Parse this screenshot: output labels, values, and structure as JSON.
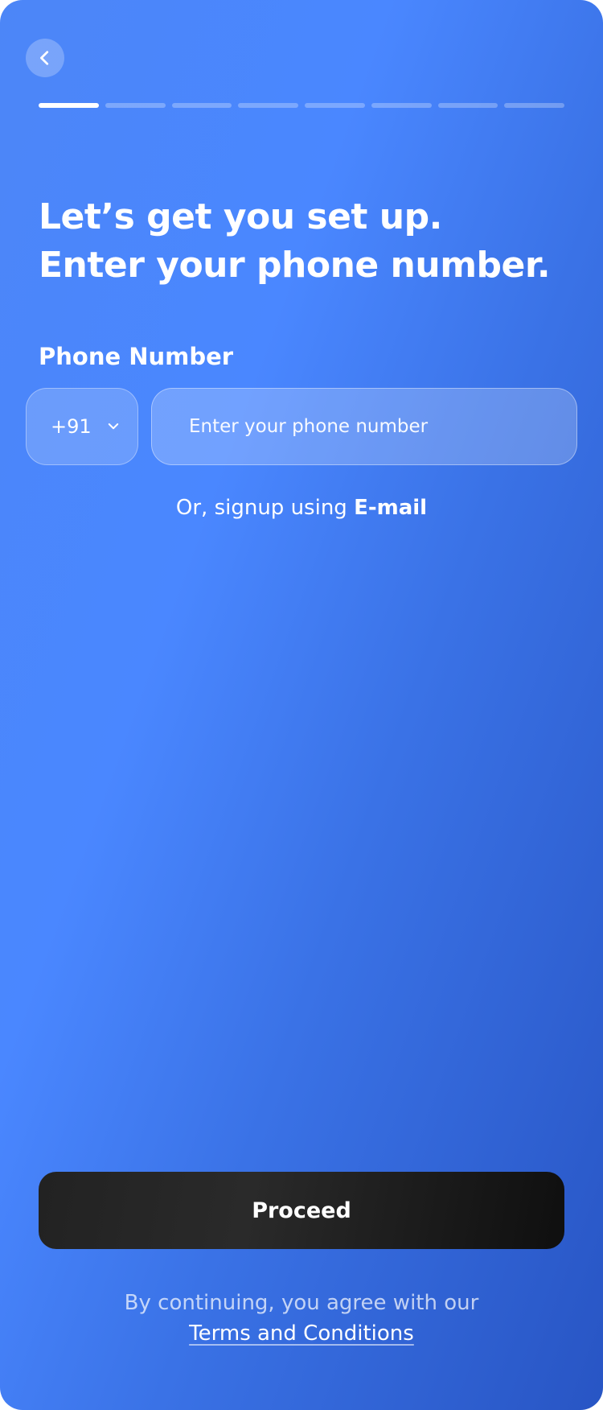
{
  "nav": {
    "back_icon": "chevron-left-icon"
  },
  "progress": {
    "current_step": 1,
    "total_steps": 8
  },
  "heading": {
    "line1": "Let’s get you set up.",
    "line2": "Enter your phone number."
  },
  "phone": {
    "label": "Phone Number",
    "country_code": "+91",
    "country_dropdown_icon": "chevron-down-icon",
    "placeholder": "Enter your phone number",
    "value": ""
  },
  "alt_signup": {
    "prefix": "Or, signup using ",
    "link": "E-mail"
  },
  "actions": {
    "proceed_label": "Proceed"
  },
  "legal": {
    "text": "By continuing, you agree with our",
    "link": "Terms and Conditions"
  },
  "colors": {
    "background_start": "#4a87ff",
    "background_end": "#2855c4",
    "button": "#1c1c1c",
    "text": "#ffffff"
  }
}
